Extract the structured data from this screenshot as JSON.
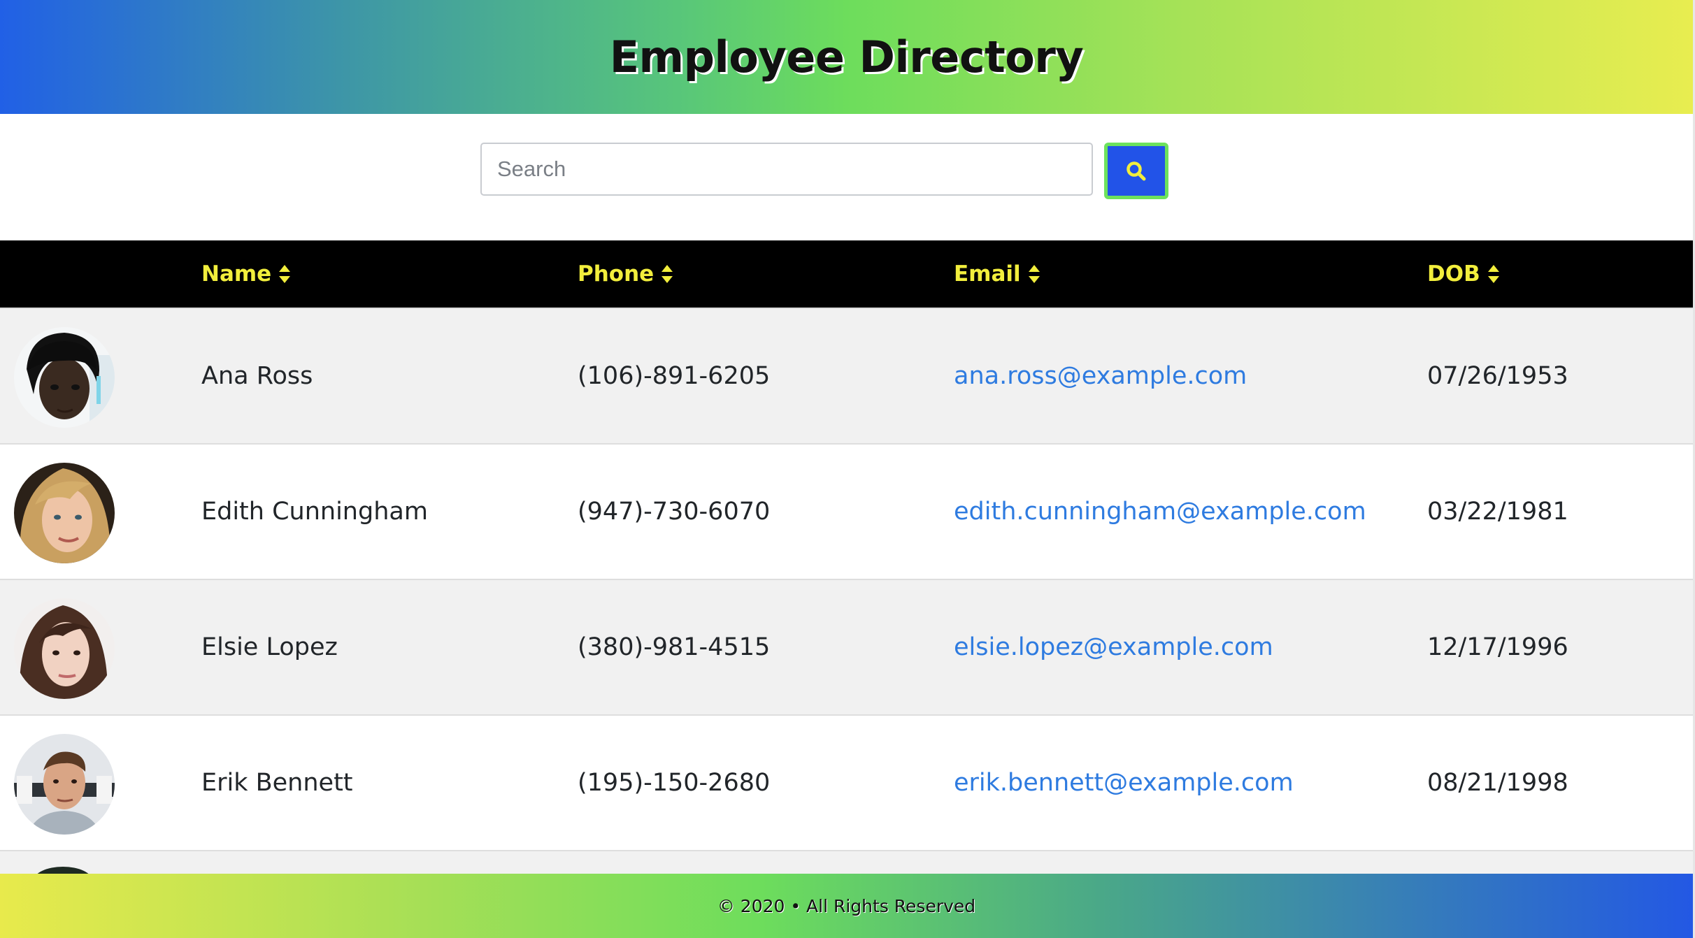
{
  "header": {
    "title": "Employee Directory"
  },
  "search": {
    "placeholder": "Search",
    "value": ""
  },
  "table": {
    "columns": [
      "Name",
      "Phone",
      "Email",
      "DOB"
    ],
    "rows": [
      {
        "name": "Ana Ross",
        "phone": "(106)-891-6205",
        "email": "ana.ross@example.com",
        "dob": "07/26/1953"
      },
      {
        "name": "Edith Cunningham",
        "phone": "(947)-730-6070",
        "email": "edith.cunningham@example.com",
        "dob": "03/22/1981"
      },
      {
        "name": "Elsie Lopez",
        "phone": "(380)-981-4515",
        "email": "elsie.lopez@example.com",
        "dob": "12/17/1996"
      },
      {
        "name": "Erik Bennett",
        "phone": "(195)-150-2680",
        "email": "erik.bennett@example.com",
        "dob": "08/21/1998"
      }
    ]
  },
  "footer": {
    "text": "© 2020 • All Rights Reserved"
  },
  "icons": {
    "search_button": "search-icon",
    "sort": "sort-icon"
  },
  "colors": {
    "header_text_accent": "#f2ee3c",
    "button_bg": "#2253e8",
    "button_border": "#6de25c",
    "link": "#2e7be0"
  }
}
